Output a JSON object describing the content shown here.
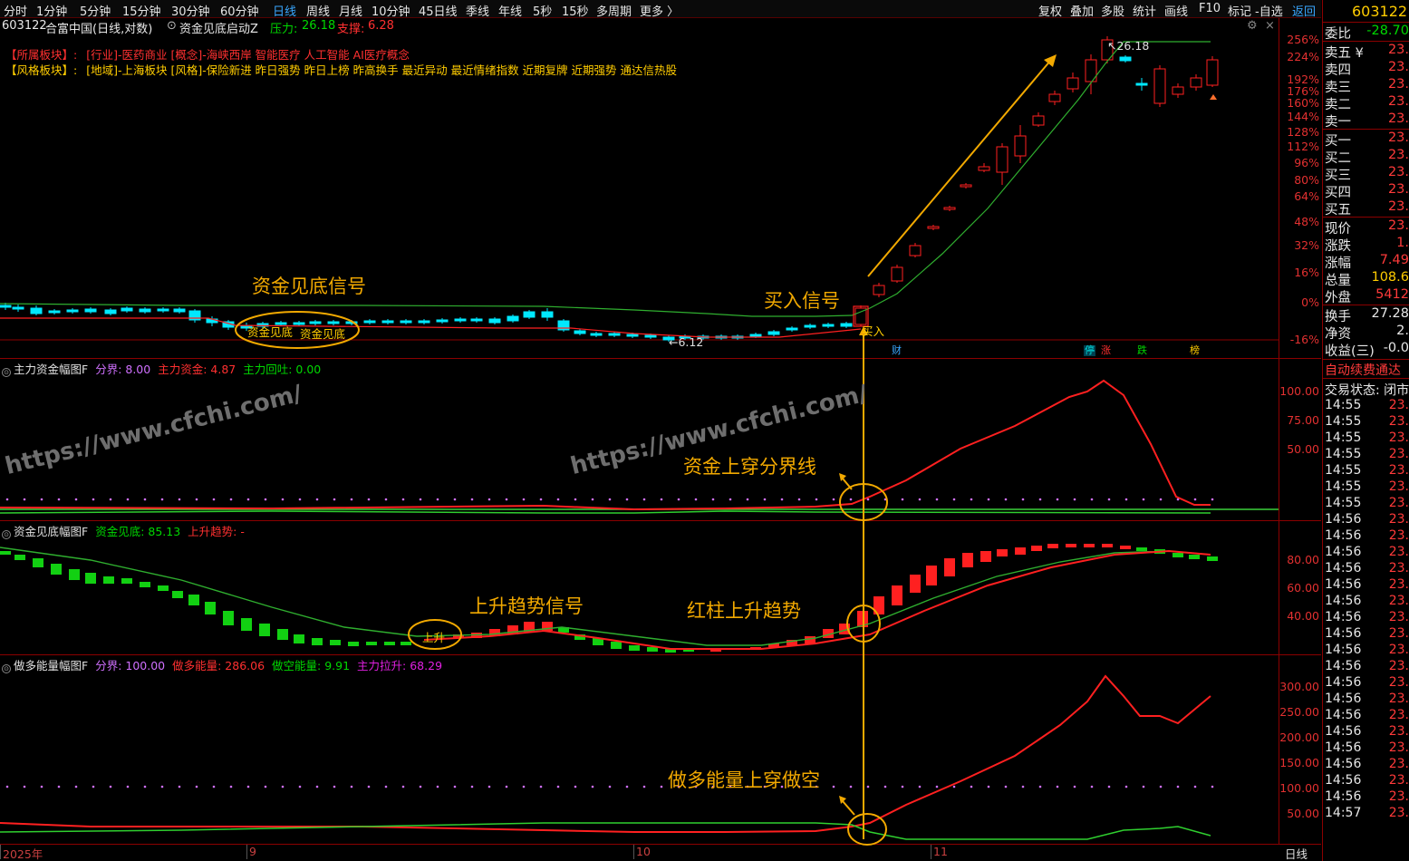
{
  "toolbar": {
    "timeframes": [
      "分时",
      "1分钟",
      "5分钟",
      "15分钟",
      "30分钟",
      "60分钟",
      "日线",
      "周线",
      "月线",
      "10分钟",
      "45日线",
      "季线",
      "年线",
      "5秒",
      "15秒",
      "多周期",
      "更多 〉"
    ],
    "active_timeframe": "日线",
    "tools": [
      "复权",
      "叠加",
      "多股",
      "统计",
      "画线",
      "F10",
      "标记",
      "-自选",
      "返回"
    ]
  },
  "header": {
    "code": "603122",
    "name_period": "合富中国(日线,对数)",
    "indicator": "资金见底启动Z",
    "pressure_label": "压力:",
    "pressure_value": "26.18",
    "support_label": "支撑:",
    "support_value": "6.28"
  },
  "sectors": {
    "line1_label": "【所属板块】:",
    "line1_text": "[行业]-医药商业 [概念]-海峡西岸 智能医疗 人工智能 AI医疗概念",
    "line2_label": "【风格板块】:",
    "line2_text": "[地域]-上海板块 [风格]-保险新进 昨日强势 昨日上榜 昨高换手 最近异动 最近情绪指数 近期复牌 近期强势 通达信热股"
  },
  "price_axis": [
    "256%",
    "224%",
    "192%",
    "176%",
    "160%",
    "144%",
    "128%",
    "112%",
    "96%",
    "80%",
    "64%",
    "48%",
    "32%",
    "16%",
    "0%",
    "-16%"
  ],
  "price_labels": {
    "high": "26.18",
    "low": "6.12",
    "buy": "买入",
    "bottom1": "资金见底",
    "bottom2": "资金见底"
  },
  "event_tags": [
    "财",
    "停",
    "涨",
    "跌",
    "榜"
  ],
  "ind1": {
    "name": "主力资金幅图F",
    "l1": "分界: 8.00",
    "l2": "主力资金: 4.87",
    "l3": "主力回吐: 0.00",
    "axis": [
      "100.00",
      "75.00",
      "50.00"
    ]
  },
  "ind2": {
    "name": "资金见底幅图F",
    "l1": "资金见底: 85.13",
    "l2": "上升趋势: -",
    "axis": [
      "80.00",
      "60.00",
      "40.00"
    ],
    "up_label": "上升"
  },
  "ind3": {
    "name": "做多能量幅图F",
    "l1": "分界: 100.00",
    "l2": "做多能量: 286.06",
    "l3": "做空能量: 9.91",
    "l4": "主力拉升: 68.29",
    "axis": [
      "300.00",
      "250.00",
      "200.00",
      "150.00",
      "100.00",
      "50.00"
    ]
  },
  "dates": [
    "2025年",
    "9",
    "10",
    "11"
  ],
  "period_label": "日线",
  "annotations": {
    "a1": "资金见底信号",
    "a2": "买入信号",
    "a3": "资金上穿分界线",
    "a4": "上升趋势信号",
    "a5": "红柱上升趋势",
    "a6": "做多能量上穿做空"
  },
  "watermark": "https://www.cfchi.com/",
  "right_panel": {
    "code": "603122",
    "weibi_label": "委比",
    "weibi_value": "-28.70",
    "asks": [
      {
        "label": "卖五 ¥",
        "value": "23."
      },
      {
        "label": "卖四",
        "value": "23."
      },
      {
        "label": "卖三",
        "value": "23."
      },
      {
        "label": "卖二",
        "value": "23."
      },
      {
        "label": "卖一",
        "value": "23."
      }
    ],
    "bids": [
      {
        "label": "买一",
        "value": "23."
      },
      {
        "label": "买二",
        "value": "23."
      },
      {
        "label": "买三",
        "value": "23."
      },
      {
        "label": "买四",
        "value": "23."
      },
      {
        "label": "买五",
        "value": "23."
      }
    ],
    "stats": [
      {
        "label": "现价",
        "value": "23."
      },
      {
        "label": "涨跌",
        "value": "1."
      },
      {
        "label": "涨幅",
        "value": "7.49"
      },
      {
        "label": "总量",
        "value": "108.6"
      },
      {
        "label": "外盘",
        "value": "5412"
      }
    ],
    "stats2": [
      {
        "label": "换手",
        "value": "27.28"
      },
      {
        "label": "净资",
        "value": "2."
      },
      {
        "label": "收益(三)",
        "value": "-0.0"
      }
    ],
    "promo": "自动续费通达",
    "trade_status": "交易状态: 闭市",
    "ticks": [
      {
        "t": "14:55",
        "v": "23."
      },
      {
        "t": "14:55",
        "v": "23."
      },
      {
        "t": "14:55",
        "v": "23."
      },
      {
        "t": "14:55",
        "v": "23."
      },
      {
        "t": "14:55",
        "v": "23."
      },
      {
        "t": "14:55",
        "v": "23."
      },
      {
        "t": "14:55",
        "v": "23."
      },
      {
        "t": "14:56",
        "v": "23."
      },
      {
        "t": "14:56",
        "v": "23."
      },
      {
        "t": "14:56",
        "v": "23."
      },
      {
        "t": "14:56",
        "v": "23."
      },
      {
        "t": "14:56",
        "v": "23."
      },
      {
        "t": "14:56",
        "v": "23."
      },
      {
        "t": "14:56",
        "v": "23."
      },
      {
        "t": "14:56",
        "v": "23."
      },
      {
        "t": "14:56",
        "v": "23."
      },
      {
        "t": "14:56",
        "v": "23."
      },
      {
        "t": "14:56",
        "v": "23."
      },
      {
        "t": "14:56",
        "v": "23."
      },
      {
        "t": "14:56",
        "v": "23."
      },
      {
        "t": "14:56",
        "v": "23."
      },
      {
        "t": "14:56",
        "v": "23."
      },
      {
        "t": "14:56",
        "v": "23."
      },
      {
        "t": "14:56",
        "v": "23."
      },
      {
        "t": "14:56",
        "v": "23."
      },
      {
        "t": "14:57",
        "v": "23."
      }
    ]
  },
  "colors": {
    "up": "#ff2020",
    "down": "#00e8ff",
    "signal": "#f2a900",
    "bg": "#000000"
  }
}
